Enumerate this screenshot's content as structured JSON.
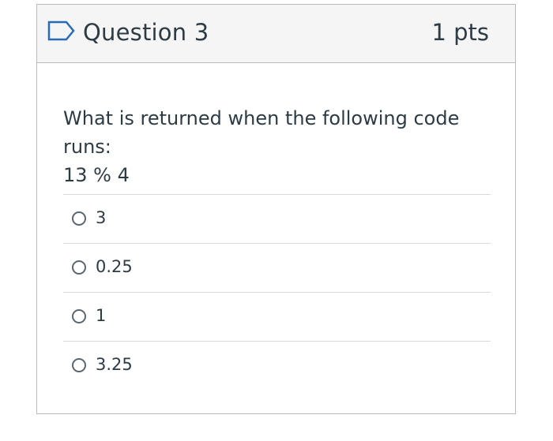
{
  "header": {
    "title": "Question 3",
    "points": "1 pts",
    "flag_icon": "flag-outline-icon"
  },
  "question": {
    "line1": "What is returned when the following code runs:",
    "line2": "13 % 4"
  },
  "answers": [
    {
      "label": "3",
      "selected": false
    },
    {
      "label": "0.25",
      "selected": false
    },
    {
      "label": "1",
      "selected": false
    },
    {
      "label": "3.25",
      "selected": false
    }
  ],
  "colors": {
    "text": "#2d3b45",
    "border": "#b7bcc0",
    "header_bg": "#f5f5f5",
    "divider": "#d7dadc",
    "flag_blue": "#2b6bb5"
  }
}
